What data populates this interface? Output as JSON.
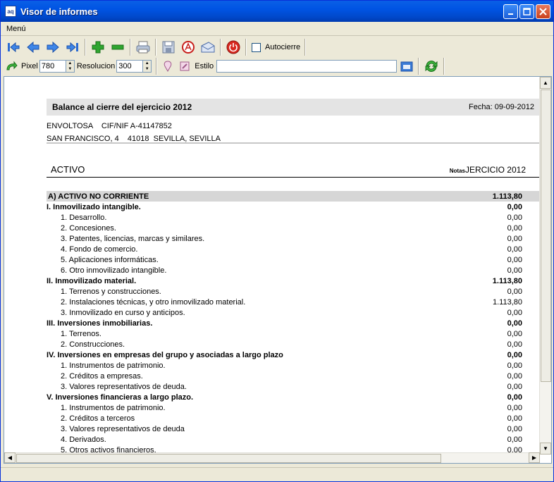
{
  "window": {
    "title": "Visor de informes",
    "icon_text": "aq"
  },
  "menu": {
    "items": [
      {
        "label": "Menú"
      }
    ]
  },
  "toolbar": {
    "autocierre_label": "Autocierre",
    "pixel_label": "Pixel",
    "pixel_value": "780",
    "resolucion_label": "Resolucion",
    "resolucion_value": "300",
    "estilo_label": "Estilo",
    "estilo_value": ""
  },
  "report": {
    "title": "Balance al cierre del ejercicio 2012",
    "fecha": "Fecha: 09-09-2012",
    "company_line1": "ENVOLTOSA    CIF/NIF A-41147852",
    "company_line2": "SAN FRANCISCO, 4    41018  SEVILLA, SEVILLA",
    "section_title": "ACTIVO",
    "col_notas": "Notas",
    "col_ejercicio": "JERCICIO 2012",
    "rows": [
      {
        "level": 0,
        "label": "A) ACTIVO NO CORRIENTE",
        "value": "1.113,80"
      },
      {
        "level": 1,
        "label": "I. Inmovilizado intangible.",
        "value": "0,00"
      },
      {
        "level": 2,
        "label": "1. Desarrollo.",
        "value": "0,00"
      },
      {
        "level": 2,
        "label": "2. Concesiones.",
        "value": "0,00"
      },
      {
        "level": 2,
        "label": "3. Patentes, licencias, marcas y similares.",
        "value": "0,00"
      },
      {
        "level": 2,
        "label": "4. Fondo de comercio.",
        "value": "0,00"
      },
      {
        "level": 2,
        "label": "5. Aplicaciones informáticas.",
        "value": "0,00"
      },
      {
        "level": 2,
        "label": "6. Otro inmovilizado intangible.",
        "value": "0,00"
      },
      {
        "level": 1,
        "label": "II. Inmovilizado material.",
        "value": "1.113,80"
      },
      {
        "level": 2,
        "label": "1. Terrenos y construcciones.",
        "value": "0,00"
      },
      {
        "level": 2,
        "label": "2. Instalaciones técnicas, y otro inmovilizado material.",
        "value": "1.113,80"
      },
      {
        "level": 2,
        "label": "3. Inmovilizado en curso y anticipos.",
        "value": "0,00"
      },
      {
        "level": 1,
        "label": "III. Inversiones inmobiliarias.",
        "value": "0,00"
      },
      {
        "level": 2,
        "label": "1. Terrenos.",
        "value": "0,00"
      },
      {
        "level": 2,
        "label": "2. Construcciones.",
        "value": "0,00"
      },
      {
        "level": 1,
        "label": "IV. Inversiones en empresas del grupo y asociadas a largo plazo",
        "value": "0,00"
      },
      {
        "level": 2,
        "label": "1. Instrumentos de patrimonio.",
        "value": "0,00"
      },
      {
        "level": 2,
        "label": "2. Créditos a empresas.",
        "value": "0,00"
      },
      {
        "level": 2,
        "label": "3. Valores representativos de deuda.",
        "value": "0,00"
      },
      {
        "level": 1,
        "label": "V. Inversiones financieras a largo plazo.",
        "value": "0,00"
      },
      {
        "level": 2,
        "label": "1. Instrumentos de patrimonio.",
        "value": "0,00"
      },
      {
        "level": 2,
        "label": "2. Créditos a terceros",
        "value": "0,00"
      },
      {
        "level": 2,
        "label": "3. Valores representativos de deuda",
        "value": "0,00"
      },
      {
        "level": 2,
        "label": "4. Derivados.",
        "value": "0,00"
      },
      {
        "level": 2,
        "label": "5. Otros activos financieros.",
        "value": "0,00"
      }
    ]
  },
  "colors": {
    "title_bar": "#0054E3",
    "band": "#E4E4E4",
    "row_highlight": "#D6D6D6"
  },
  "icons": [
    "first-page-icon",
    "prev-page-icon",
    "next-page-icon",
    "last-page-icon",
    "zoom-in-icon",
    "zoom-out-icon",
    "print-icon",
    "save-icon",
    "pdf-icon",
    "email-icon",
    "power-icon",
    "refresh-arrow-icon",
    "style-icon",
    "style-edit-icon",
    "folder-icon",
    "reload-icon"
  ]
}
